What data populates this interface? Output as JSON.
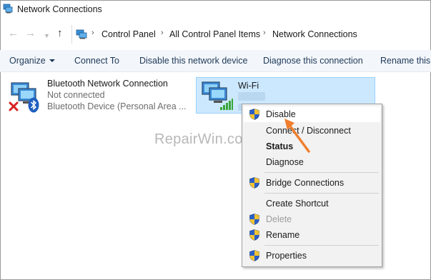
{
  "window": {
    "title": "Network Connections"
  },
  "address": {
    "crumbs": [
      "Control Panel",
      "All Control Panel Items",
      "Network Connections"
    ]
  },
  "commands": [
    "Organize",
    "Connect To",
    "Disable this network device",
    "Diagnose this connection",
    "Rename this"
  ],
  "connections": [
    {
      "name": "Bluetooth Network Connection",
      "status": "Not connected",
      "device": "Bluetooth Device (Personal Area ..."
    },
    {
      "name": "Wi-Fi"
    }
  ],
  "watermark": "RepairWin.com",
  "context_menu": {
    "items": [
      {
        "label": "Disable",
        "shield": true,
        "highlighted": true
      },
      {
        "label": "Connect / Disconnect"
      },
      {
        "label": "Status",
        "bold": true
      },
      {
        "label": "Diagnose"
      },
      {
        "label": "Bridge Connections",
        "shield": true
      },
      {
        "label": "Create Shortcut"
      },
      {
        "label": "Delete",
        "shield": true,
        "disabled": true
      },
      {
        "label": "Rename",
        "shield": true
      },
      {
        "label": "Properties",
        "shield": true
      }
    ]
  },
  "colors": {
    "accent_arrow": "#f07f2d",
    "selection": "#cce8ff",
    "command_text": "#1e3957"
  }
}
